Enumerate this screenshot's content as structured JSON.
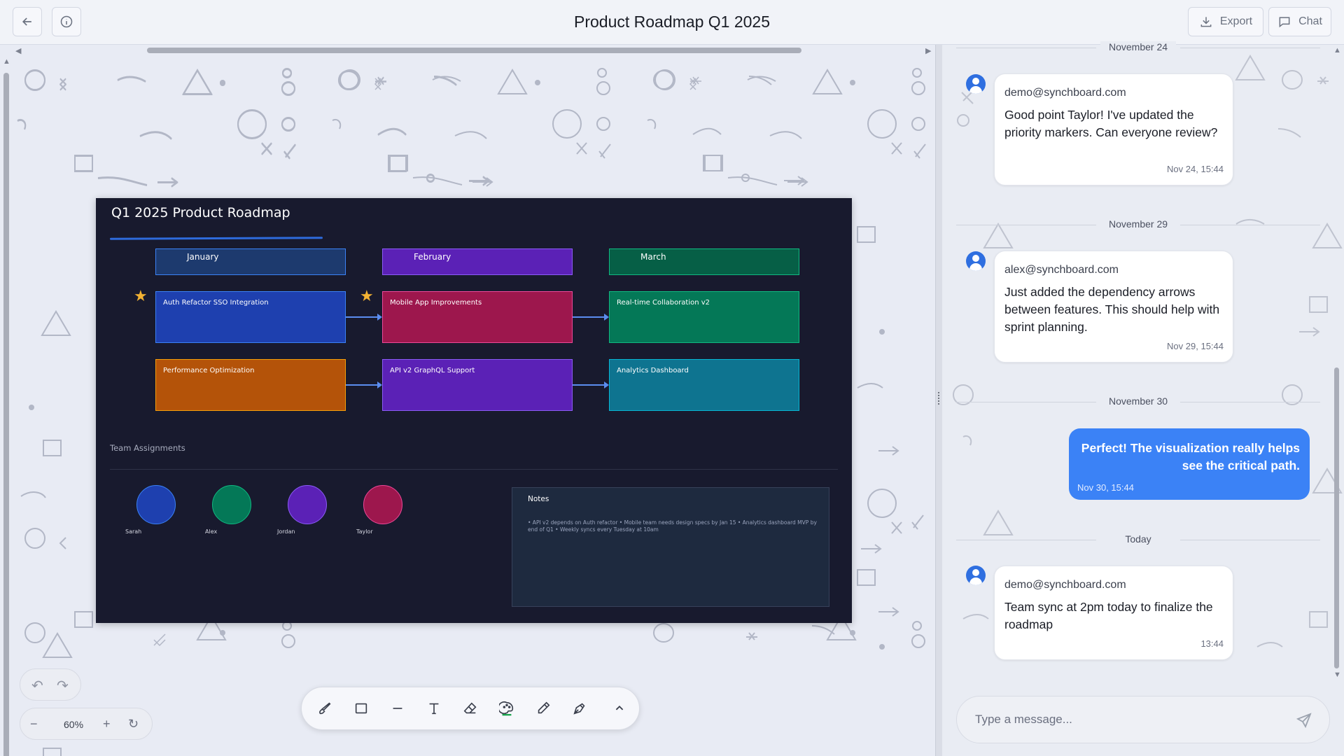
{
  "header": {
    "title": "Product Roadmap Q1 2025",
    "export_label": "Export",
    "chat_label": "Chat"
  },
  "board": {
    "title": "Q1 2025 Product Roadmap",
    "months": [
      "January",
      "February",
      "March"
    ],
    "features_row1": [
      "Auth Refactor SSO Integration",
      "Mobile App Improvements",
      "Real-time Collaboration v2"
    ],
    "features_row2": [
      "Performance Optimization",
      "API v2 GraphQL Support",
      "Analytics Dashboard"
    ],
    "team_label": "Team Assignments",
    "members": [
      "Sarah",
      "Alex",
      "Jordan",
      "Taylor"
    ],
    "notes_title": "Notes",
    "notes_body": "• API v2 depends on Auth refactor • Mobile team needs design specs by Jan 15 • Analytics dashboard MVP by end of Q1 • Weekly syncs every Tuesday at 10am",
    "colors": {
      "background": "#181a2e",
      "january": "#1d3a6e",
      "february": "#5b21b6",
      "march": "#065f46",
      "auth": "#1e40af",
      "mobile": "#9d174d",
      "realtime": "#047857",
      "performance": "#b45309",
      "api": "#5b21b6",
      "analytics": "#0e7490",
      "star": "#f2b233"
    }
  },
  "controls": {
    "zoom": "60%",
    "tools": [
      "brush-tool",
      "rectangle-tool",
      "line-tool",
      "text-tool",
      "eraser-tool",
      "palette-tool",
      "eyedropper-tool",
      "pen-tool",
      "collapse-toolbar"
    ]
  },
  "chat": {
    "messages": [
      {
        "date": "November 24",
        "from": "demo@synchboard.com",
        "text": "Good point Taylor! I've updated the priority markers. Can everyone review?",
        "time": "Nov 24, 15:44"
      },
      {
        "date": "November 29",
        "from": "alex@synchboard.com",
        "text": "Just added the dependency arrows between features. This should help with sprint planning.",
        "time": "Nov 29, 15:44"
      },
      {
        "date": "November 30",
        "from": "me",
        "text": "Perfect! The visualization really helps see the critical path.",
        "time": "Nov 30, 15:44"
      },
      {
        "date": "Today",
        "from": "demo@synchboard.com",
        "text": "Team sync at 2pm today to finalize the roadmap",
        "time": "13:44"
      }
    ],
    "input_placeholder": "Type a message...",
    "accent": "#3b82f6"
  }
}
